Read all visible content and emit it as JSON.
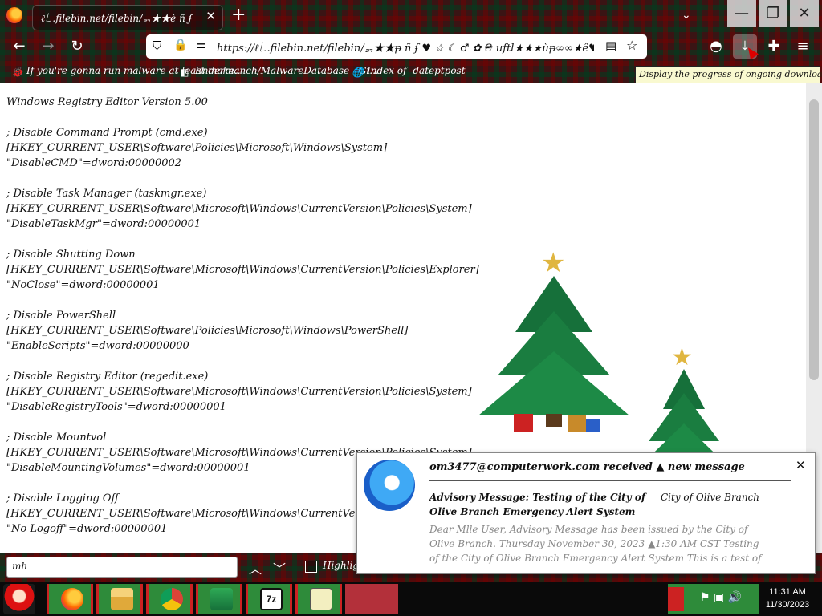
{
  "browser": {
    "tab_title": "ℓ꒒.filebin.net/filebin/ᆰ★★ѐ ñ ʄ ♥ ☆ ☾ ♂",
    "tab_close": "✕",
    "new_tab": "+",
    "tab_list": "⌄",
    "window_min": "—",
    "window_max": "❐",
    "window_close": "✕",
    "url": "https://ℓ꒒.filebin.net/filebin/ᆰ★★ᵽ ñ ʄ ♥ ☆ ☾ ♂ ✿ ₴ uftl★★★ùᵽ∞∞★ê♥■❄♥☗☗◈",
    "nav_back": "←",
    "nav_forward": "→",
    "nav_reload": "↻",
    "icon_shield": "⛉",
    "icon_lock": "🔒",
    "icon_perm": "⚌",
    "icon_reader": "▤",
    "icon_star": "☆",
    "icon_pocket": "◓",
    "icon_download": "⤓",
    "icon_extensions": "✚",
    "icon_menu": "≡"
  },
  "bookmarks": [
    {
      "label": "If you're gonna run malware at least make...",
      "icon": "🐞"
    },
    {
      "label": "Endermanch/MalwareDatabase - Gi...",
      "icon": "◧"
    },
    {
      "label": "Index of -dateptpost",
      "icon": "🌐"
    }
  ],
  "tooltip": "Display the progress of ongoing downloads (Ctrl+J)",
  "document_lines": [
    "Windows Registry Editor Version 5.00",
    "",
    "; Disable Command Prompt (cmd.exe)",
    "[HKEY_CURRENT_USER\\Software\\Policies\\Microsoft\\Windows\\System]",
    "\"DisableCMD\"=dword:00000002",
    "",
    "; Disable Task Manager (taskmgr.exe)",
    "[HKEY_CURRENT_USER\\Software\\Microsoft\\Windows\\CurrentVersion\\Policies\\System]",
    "\"DisableTaskMgr\"=dword:00000001",
    "",
    "; Disable Shutting Down",
    "[HKEY_CURRENT_USER\\Software\\Microsoft\\Windows\\CurrentVersion\\Policies\\Explorer]",
    "\"NoClose\"=dword:00000001",
    "",
    "; Disable PowerShell",
    "[HKEY_CURRENT_USER\\Software\\Policies\\Microsoft\\Windows\\PowerShell]",
    "\"EnableScripts\"=dword:00000000",
    "",
    "; Disable Registry Editor (regedit.exe)",
    "[HKEY_CURRENT_USER\\Software\\Microsoft\\Windows\\CurrentVersion\\Policies\\System]",
    "\"DisableRegistryTools\"=dword:00000001",
    "",
    "; Disable Mountvol",
    "[HKEY_CURRENT_USER\\Software\\Microsoft\\Windows\\CurrentVersion\\Policies\\System]",
    "\"DisableMountingVolumes\"=dword:00000001",
    "",
    "; Disable Logging Off",
    "[HKEY_CURRENT_USER\\Software\\Microsoft\\Windows\\CurrentVersion\\Policies\\Explorer]",
    "\"No Logoff\"=dword:00000001"
  ],
  "findbar": {
    "value": "mh",
    "prev": "︿",
    "next": "﹀",
    "highlight_label": "Highlight"
  },
  "notification": {
    "header": "om3477@computerwork.com received ▲ new message",
    "subject": "Advisory Message: Testing of the City of Olive Branch Emergency Alert System",
    "sender": "City of Olive Branch",
    "body": "Dear Mlle User, Advisory Message has been issued by the City of Olive Branch. Thursday November 30, 2023 ▲1:30 AM CST Testing of the City of Olive Branch Emergency Alert System This is a test of the City of Olive Branch Emergency Alert Syste",
    "close": "✕"
  },
  "taskbar": {
    "clock_time": "11:31 AM",
    "clock_date": "11/30/2023",
    "tray_icons": "⚑ ▣ 🔊"
  },
  "colors": {
    "accent": "#2e8b3a",
    "tartan_red": "#b3303a",
    "tooltip_bg": "#f9f9d0"
  }
}
